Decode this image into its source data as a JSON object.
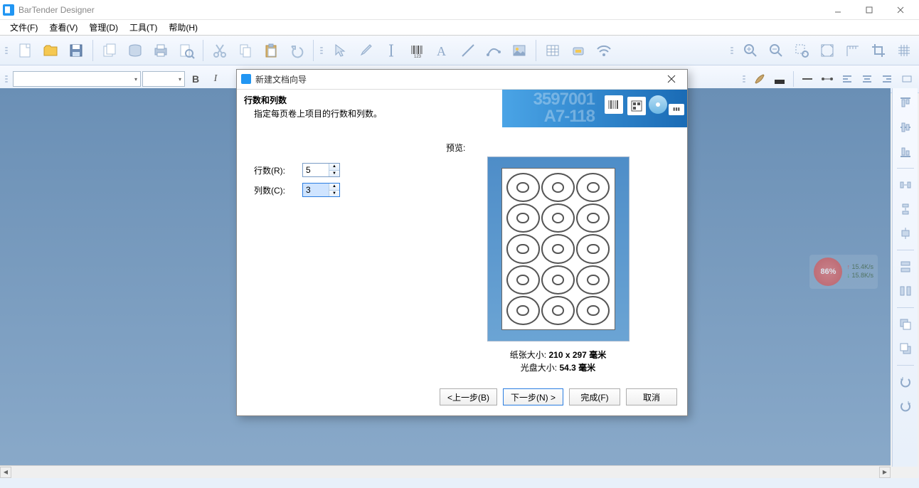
{
  "app": {
    "title": "BarTender Designer"
  },
  "menu": {
    "file": "文件(F)",
    "view": "查看(V)",
    "manage": "管理(D)",
    "tools": "工具(T)",
    "help": "帮助(H)"
  },
  "dialog": {
    "title": "新建文档向导",
    "header_title": "行数和列数",
    "header_sub": "指定每页卷上项目的行数和列数。",
    "rows_label": "行数(R):",
    "cols_label": "列数(C):",
    "rows_value": "5",
    "cols_value": "3",
    "preview_label": "预览:",
    "paper_size_label": "纸张大小:",
    "paper_size_value": "210 x 297 毫米",
    "disc_size_label": "光盘大小:",
    "disc_size_value": "54.3 毫米",
    "btn_back": "<上一步(B)",
    "btn_next": "下一步(N) >",
    "btn_finish": "完成(F)",
    "btn_cancel": "取消",
    "banner_num": "3597001",
    "banner_num2": "A7-118"
  },
  "netwidget": {
    "percent": "86%",
    "up": "15.4K/s",
    "down": "15.8K/s"
  }
}
